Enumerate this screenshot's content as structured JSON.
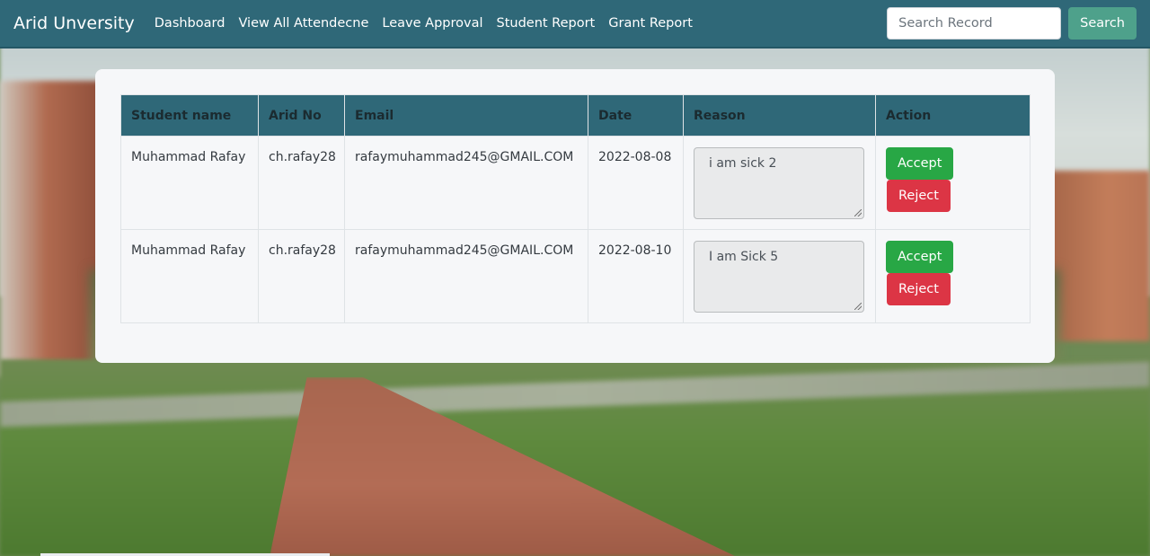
{
  "navbar": {
    "brand": "Arid Unversity",
    "links": [
      "Dashboard",
      "View All Attendecne",
      "Leave Approval",
      "Student Report",
      "Grant Report"
    ],
    "search_placeholder": "Search Record",
    "search_button": "Search"
  },
  "table": {
    "headers": [
      "Student name",
      "Arid No",
      "Email",
      "Date",
      "Reason",
      "Action"
    ],
    "rows": [
      {
        "student_name": "Muhammad Rafay",
        "arid_no": "ch.rafay28",
        "email": "rafaymuhammad245@GMAIL.COM",
        "date": "2022-08-08",
        "reason": "i am sick 2",
        "accept": "Accept",
        "reject": "Reject"
      },
      {
        "student_name": "Muhammad Rafay",
        "arid_no": "ch.rafay28",
        "email": "rafaymuhammad245@GMAIL.COM",
        "date": "2022-08-10",
        "reason": "I am Sick 5",
        "accept": "Accept",
        "reject": "Reject"
      }
    ]
  },
  "colors": {
    "navbar": "#2f6878",
    "search_button": "#4ea18b",
    "accept": "#28a745",
    "reject": "#dc3545"
  }
}
